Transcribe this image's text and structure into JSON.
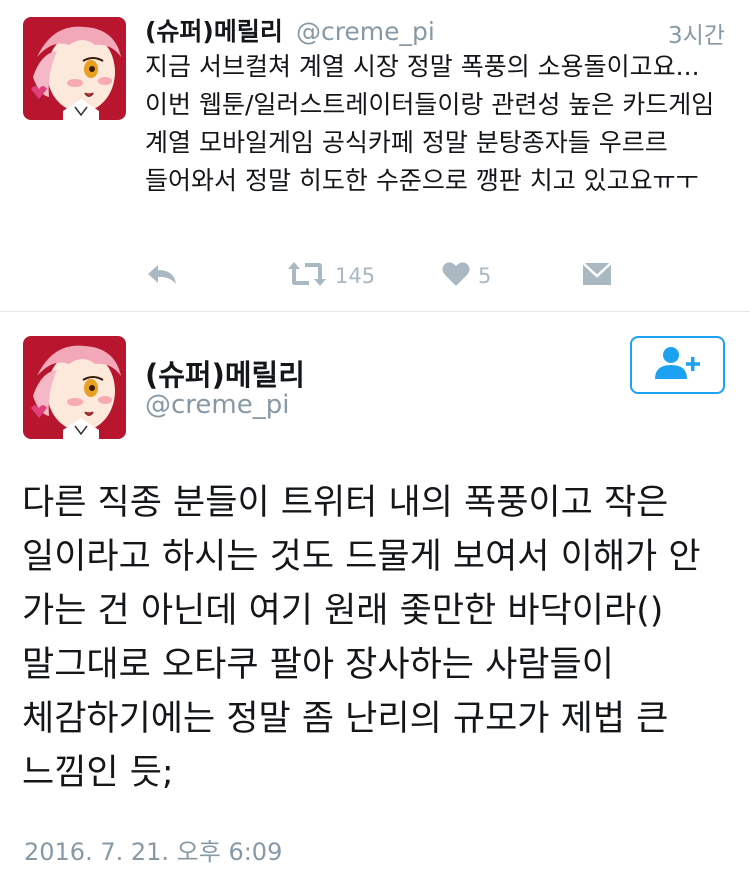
{
  "tweet_reply": {
    "author_name": "(슈퍼)메릴리",
    "author_handle": "@creme_pi",
    "time": "3시간",
    "text": "지금 서브컬쳐 계열 시장 정말 폭풍의 소용돌이고요... 이번 웹툰/일러스트레이터들이랑 관련성 높은 카드게임 계열 모바일게임 공식카페 정말 분탕종자들 우르르 들어와서 정말 히도한 수준으로 깽판 치고 있고요ㅠㅜ",
    "actions": {
      "reply_icon": "reply-icon",
      "retweet_icon": "retweet-icon",
      "retweet_count": "145",
      "like_icon": "heart-icon",
      "like_count": "5",
      "dm_icon": "envelope-icon"
    }
  },
  "tweet_main": {
    "author_name": "(슈퍼)메릴리",
    "author_handle": "@creme_pi",
    "follow_icon": "follow-user-plus-icon",
    "text": "다른 직종 분들이 트위터 내의 폭풍이고 작은 일이라고 하시는 것도 드물게 보여서 이해가 안 가는 건 아닌데 여기 원래 좇만한 바닥이라() 말그대로 오타쿠 팔아 장사하는 사람들이 체감하기에는 정말 좀 난리의 규모가 제법 큰 느낌인 듯;",
    "timestamp": "2016. 7. 21. 오후 6:09"
  },
  "colors": {
    "accent": "#1da1f2",
    "muted": "#8899a6",
    "icon": "#aab8c2",
    "text": "#14171a",
    "avatar_bg": "#b8162e",
    "avatar_hair": "#f2a8b8"
  }
}
